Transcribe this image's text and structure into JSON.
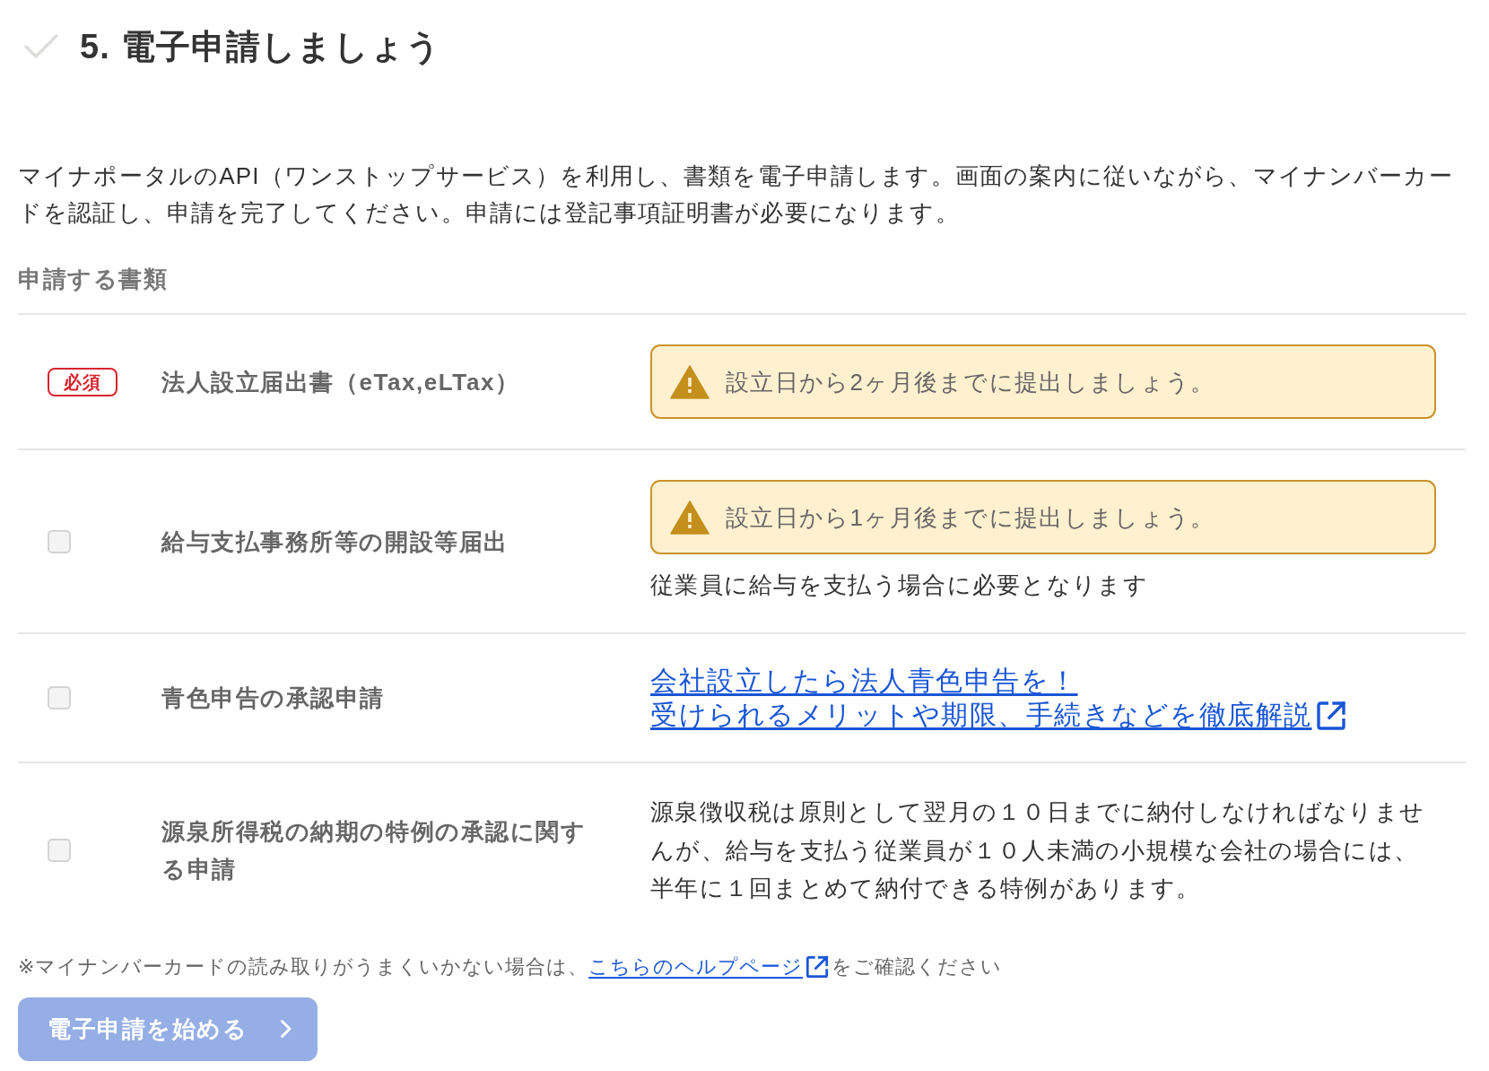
{
  "heading": {
    "title": "5. 電子申請しましょう",
    "completed": false
  },
  "intro": "マイナポータルのAPI（ワンストップサービス）を利用し、書類を電子申請します。画面の案内に従いながら、マイナンバーカードを認証し、申請を完了してください。申請には登記事項証明書が必要になります。",
  "documents": {
    "label": "申請する書類",
    "rows": [
      {
        "kind": "required",
        "badge": "必須",
        "name": "法人設立届出書（eTax,eLTax）",
        "details": [
          {
            "kind": "alert",
            "text": "設立日から2ヶ月後までに提出しましょう。"
          }
        ]
      },
      {
        "kind": "checkbox",
        "checked": false,
        "name": "給与支払事務所等の開設等届出",
        "details": [
          {
            "kind": "alert",
            "text": "設立日から1ヶ月後までに提出しましょう。"
          },
          {
            "kind": "text",
            "text": "従業員に給与を支払う場合に必要となります"
          }
        ]
      },
      {
        "kind": "checkbox",
        "checked": false,
        "name": "青色申告の承認申請",
        "details": [
          {
            "kind": "link",
            "lines": [
              "会社設立したら法人青色申告を！",
              "受けられるメリットや期限、手続きなどを徹底解説"
            ]
          }
        ]
      },
      {
        "kind": "checkbox",
        "checked": false,
        "name": "源泉所得税の納期の特例の承認に関する申請",
        "details": [
          {
            "kind": "text",
            "text": "源泉徴収税は原則として翌月の１０日までに納付しなければなりませんが、給与を支払う従業員が１０人未満の小規模な会社の場合には、半年に１回まとめて納付できる特例があります。"
          }
        ]
      }
    ]
  },
  "help_note": {
    "before": "※マイナンバーカードの読み取りがうまくいかない場合は、",
    "link": "こちらのヘルプページ",
    "after": "をご確認ください"
  },
  "start_button": {
    "label": "電子申請を始める",
    "disabled": true
  }
}
